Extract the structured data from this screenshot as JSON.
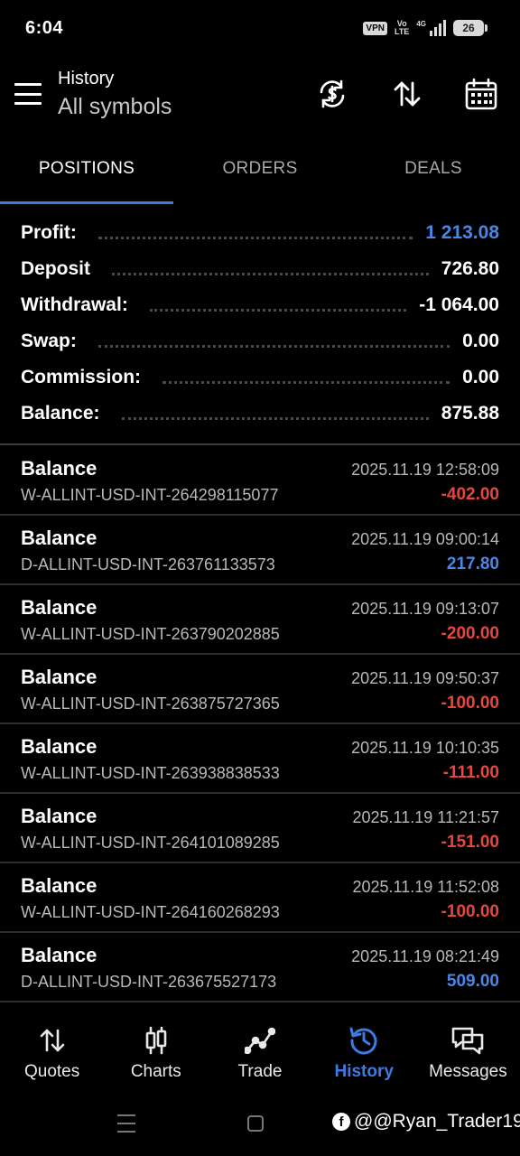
{
  "status_bar": {
    "time": "6:04",
    "vpn": "VPN",
    "volte_top": "Vo",
    "volte_bottom": "LTE",
    "network": "4G",
    "battery": "26"
  },
  "header": {
    "title": "History",
    "subtitle": "All symbols",
    "icons": [
      "currency-sync-icon",
      "sort-icon",
      "calendar-icon"
    ]
  },
  "tabs": [
    {
      "label": "POSITIONS",
      "active": true
    },
    {
      "label": "ORDERS",
      "active": false
    },
    {
      "label": "DEALS",
      "active": false
    }
  ],
  "summary": [
    {
      "label": "Profit:",
      "value": "1 213.08",
      "highlight": true
    },
    {
      "label": "Deposit",
      "value": "726.80",
      "highlight": false
    },
    {
      "label": "Withdrawal:",
      "value": "-1 064.00",
      "highlight": false
    },
    {
      "label": "Swap:",
      "value": "0.00",
      "highlight": false
    },
    {
      "label": "Commission:",
      "value": "0.00",
      "highlight": false
    },
    {
      "label": "Balance:",
      "value": "875.88",
      "highlight": false
    }
  ],
  "deals": [
    {
      "title": "Balance",
      "id": "W-ALLINT-USD-INT-264298115077",
      "time": "2025.11.19 12:58:09",
      "amount": "-402.00",
      "sign": "neg"
    },
    {
      "title": "Balance",
      "id": "D-ALLINT-USD-INT-263761133573",
      "time": "2025.11.19 09:00:14",
      "amount": "217.80",
      "sign": "pos"
    },
    {
      "title": "Balance",
      "id": "W-ALLINT-USD-INT-263790202885",
      "time": "2025.11.19 09:13:07",
      "amount": "-200.00",
      "sign": "neg"
    },
    {
      "title": "Balance",
      "id": "W-ALLINT-USD-INT-263875727365",
      "time": "2025.11.19 09:50:37",
      "amount": "-100.00",
      "sign": "neg"
    },
    {
      "title": "Balance",
      "id": "W-ALLINT-USD-INT-263938838533",
      "time": "2025.11.19 10:10:35",
      "amount": "-111.00",
      "sign": "neg"
    },
    {
      "title": "Balance",
      "id": "W-ALLINT-USD-INT-264101089285",
      "time": "2025.11.19 11:21:57",
      "amount": "-151.00",
      "sign": "neg"
    },
    {
      "title": "Balance",
      "id": "W-ALLINT-USD-INT-264160268293",
      "time": "2025.11.19 11:52:08",
      "amount": "-100.00",
      "sign": "neg"
    },
    {
      "title": "Balance",
      "id": "D-ALLINT-USD-INT-263675527173",
      "time": "2025.11.19 08:21:49",
      "amount": "509.00",
      "sign": "pos"
    }
  ],
  "bottom_nav": [
    {
      "label": "Quotes",
      "icon": "quotes-arrows-icon",
      "active": false
    },
    {
      "label": "Charts",
      "icon": "candlestick-icon",
      "active": false
    },
    {
      "label": "Trade",
      "icon": "trend-line-icon",
      "active": false
    },
    {
      "label": "History",
      "icon": "history-clock-icon",
      "active": true
    },
    {
      "label": "Messages",
      "icon": "chat-bubbles-icon",
      "active": false
    }
  ],
  "watermark": {
    "text": "@@Ryan_Trader19",
    "icon": "facebook-icon",
    "icon_glyph": "f"
  },
  "colors": {
    "accent": "#3d7be3",
    "positive": "#4a86e8",
    "negative": "#e8453c",
    "background": "#000000"
  }
}
